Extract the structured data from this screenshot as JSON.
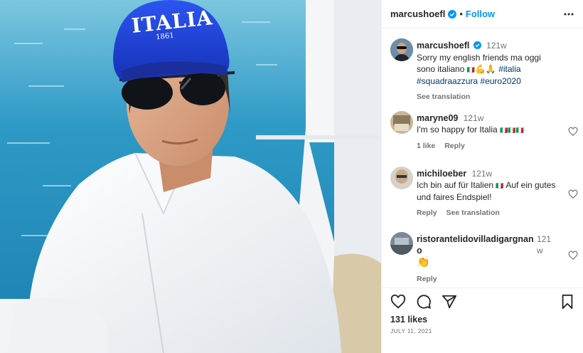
{
  "header": {
    "username": "marcushoefl",
    "separator": "•",
    "follow_label": "Follow"
  },
  "caption": {
    "username": "marcushoefl",
    "time": "121w",
    "text": "Sorry my english friends ma oggi sono italiano",
    "flag": "🇮🇹",
    "emojis": "💪🙏",
    "hashtags": "#italia #squadraazzura #euro2020",
    "see_translation": "See translation"
  },
  "comments": [
    {
      "username": "maryne09",
      "time": "121w",
      "text": "I'm so happy for Italia",
      "flags": "🇮🇹🇮🇹🇮🇹",
      "likes_label": "1 like",
      "reply_label": "Reply"
    },
    {
      "username": "michiloeber",
      "time": "121w",
      "text_a": "Ich bin auf für Italien",
      "flag": "🇮🇹",
      "text_b": "Auf ein gutes und faires Endspiel!",
      "reply_label": "Reply",
      "see_translation": "See translation"
    },
    {
      "username": "ristorantelidovilladigargnan",
      "username_tail": "o",
      "time": "121",
      "time_tail": "w",
      "text": "👏",
      "reply_label": "Reply"
    }
  ],
  "footer": {
    "likes": "131 likes",
    "date": "JULY 11, 2021"
  },
  "photo": {
    "cap_text": "ITALIA",
    "cap_year": "1861"
  },
  "colors": {
    "link": "#0095f6",
    "verified": "#0095f6",
    "cap": "#1d3fd8",
    "sea": "#1a86b8"
  }
}
